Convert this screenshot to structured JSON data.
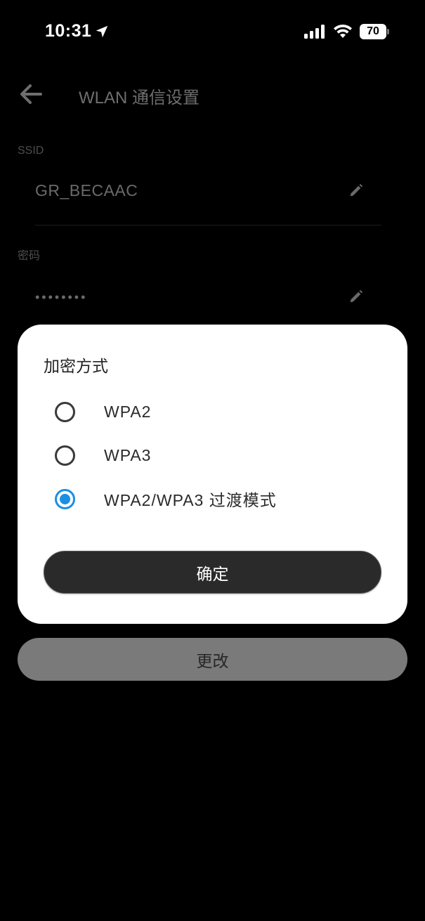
{
  "status_bar": {
    "time": "10:31",
    "battery_level": "70",
    "icons": [
      "location-arrow-icon",
      "cellular-signal-icon",
      "wifi-icon",
      "battery-icon"
    ]
  },
  "screen": {
    "title": "WLAN 通信设置",
    "back_icon": "arrow-left-icon",
    "ssid": {
      "label": "SSID",
      "value": "GR_BECAAC",
      "edit_icon": "pencil-icon"
    },
    "password": {
      "label": "密码",
      "value": "••••••••",
      "edit_icon": "pencil-icon"
    },
    "change_button_label": "更改"
  },
  "dialog": {
    "title": "加密方式",
    "options": [
      {
        "label": "WPA2",
        "selected": false
      },
      {
        "label": "WPA3",
        "selected": false
      },
      {
        "label": "WPA2/WPA3 过渡模式",
        "selected": true
      }
    ],
    "confirm_label": "确定"
  },
  "colors": {
    "background": "#000000",
    "accent": "#1a8fe3",
    "dialog_background": "#ffffff",
    "confirm_button": "#2a2a2a",
    "change_button": "#7a7a7a"
  }
}
